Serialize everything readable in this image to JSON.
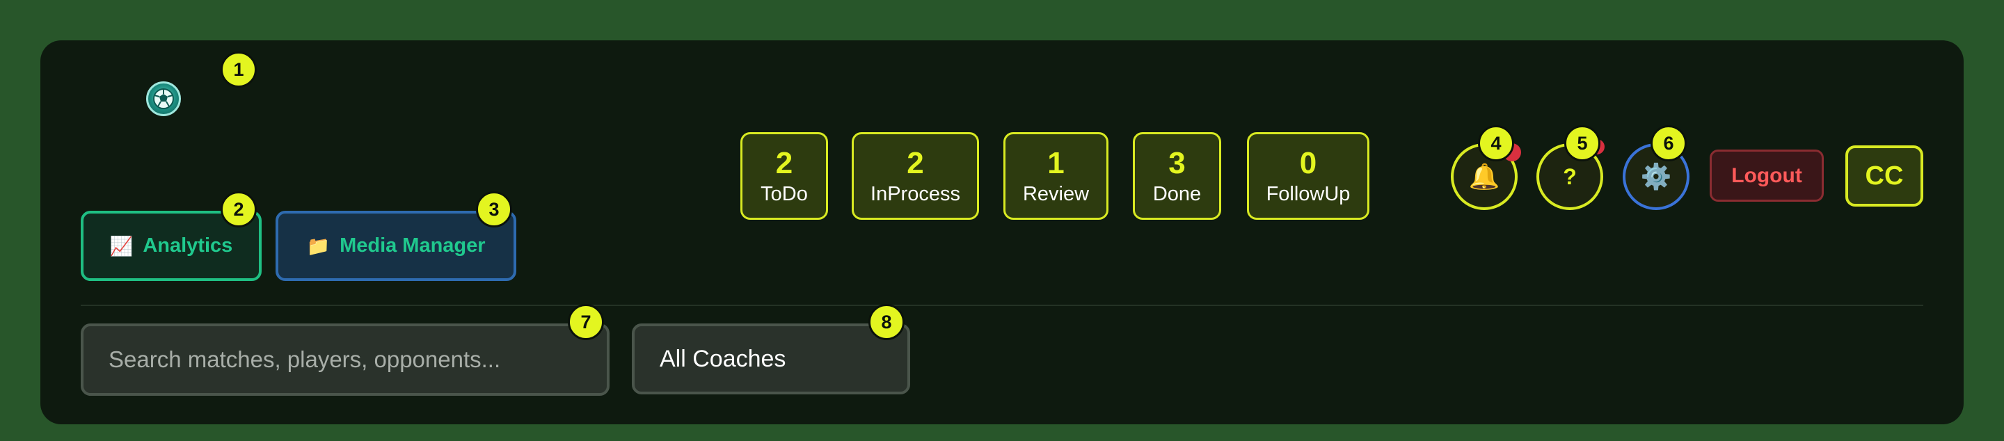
{
  "markers": [
    "1",
    "2",
    "3",
    "4",
    "5",
    "6",
    "7",
    "8"
  ],
  "nav": {
    "analytics": {
      "icon": "chart-icon",
      "glyph": "📈",
      "label": "Analytics"
    },
    "media": {
      "icon": "folder-icon",
      "glyph": "📁",
      "label": "Media Manager"
    }
  },
  "stats": [
    {
      "count": "2",
      "label": "ToDo"
    },
    {
      "count": "2",
      "label": "InProcess"
    },
    {
      "count": "1",
      "label": "Review"
    },
    {
      "count": "3",
      "label": "Done"
    },
    {
      "count": "0",
      "label": "FollowUp"
    }
  ],
  "header": {
    "bell": {
      "icon": "bell-icon",
      "glyph": "🔔"
    },
    "help": {
      "icon": "help-icon",
      "glyph": "?"
    },
    "settings": {
      "icon": "gear-icon",
      "glyph": "⚙️"
    },
    "logout_label": "Logout",
    "avatar_initials": "CC"
  },
  "filters": {
    "search_placeholder": "Search matches, players, opponents...",
    "coach_select_value": "All Coaches"
  },
  "colors": {
    "accent": "#e3f520",
    "background": "#28562a",
    "panel": "#0e1a0f",
    "analytics": "#20c98e",
    "danger": "#ff5a5a",
    "settings_border": "#3a73d8"
  }
}
